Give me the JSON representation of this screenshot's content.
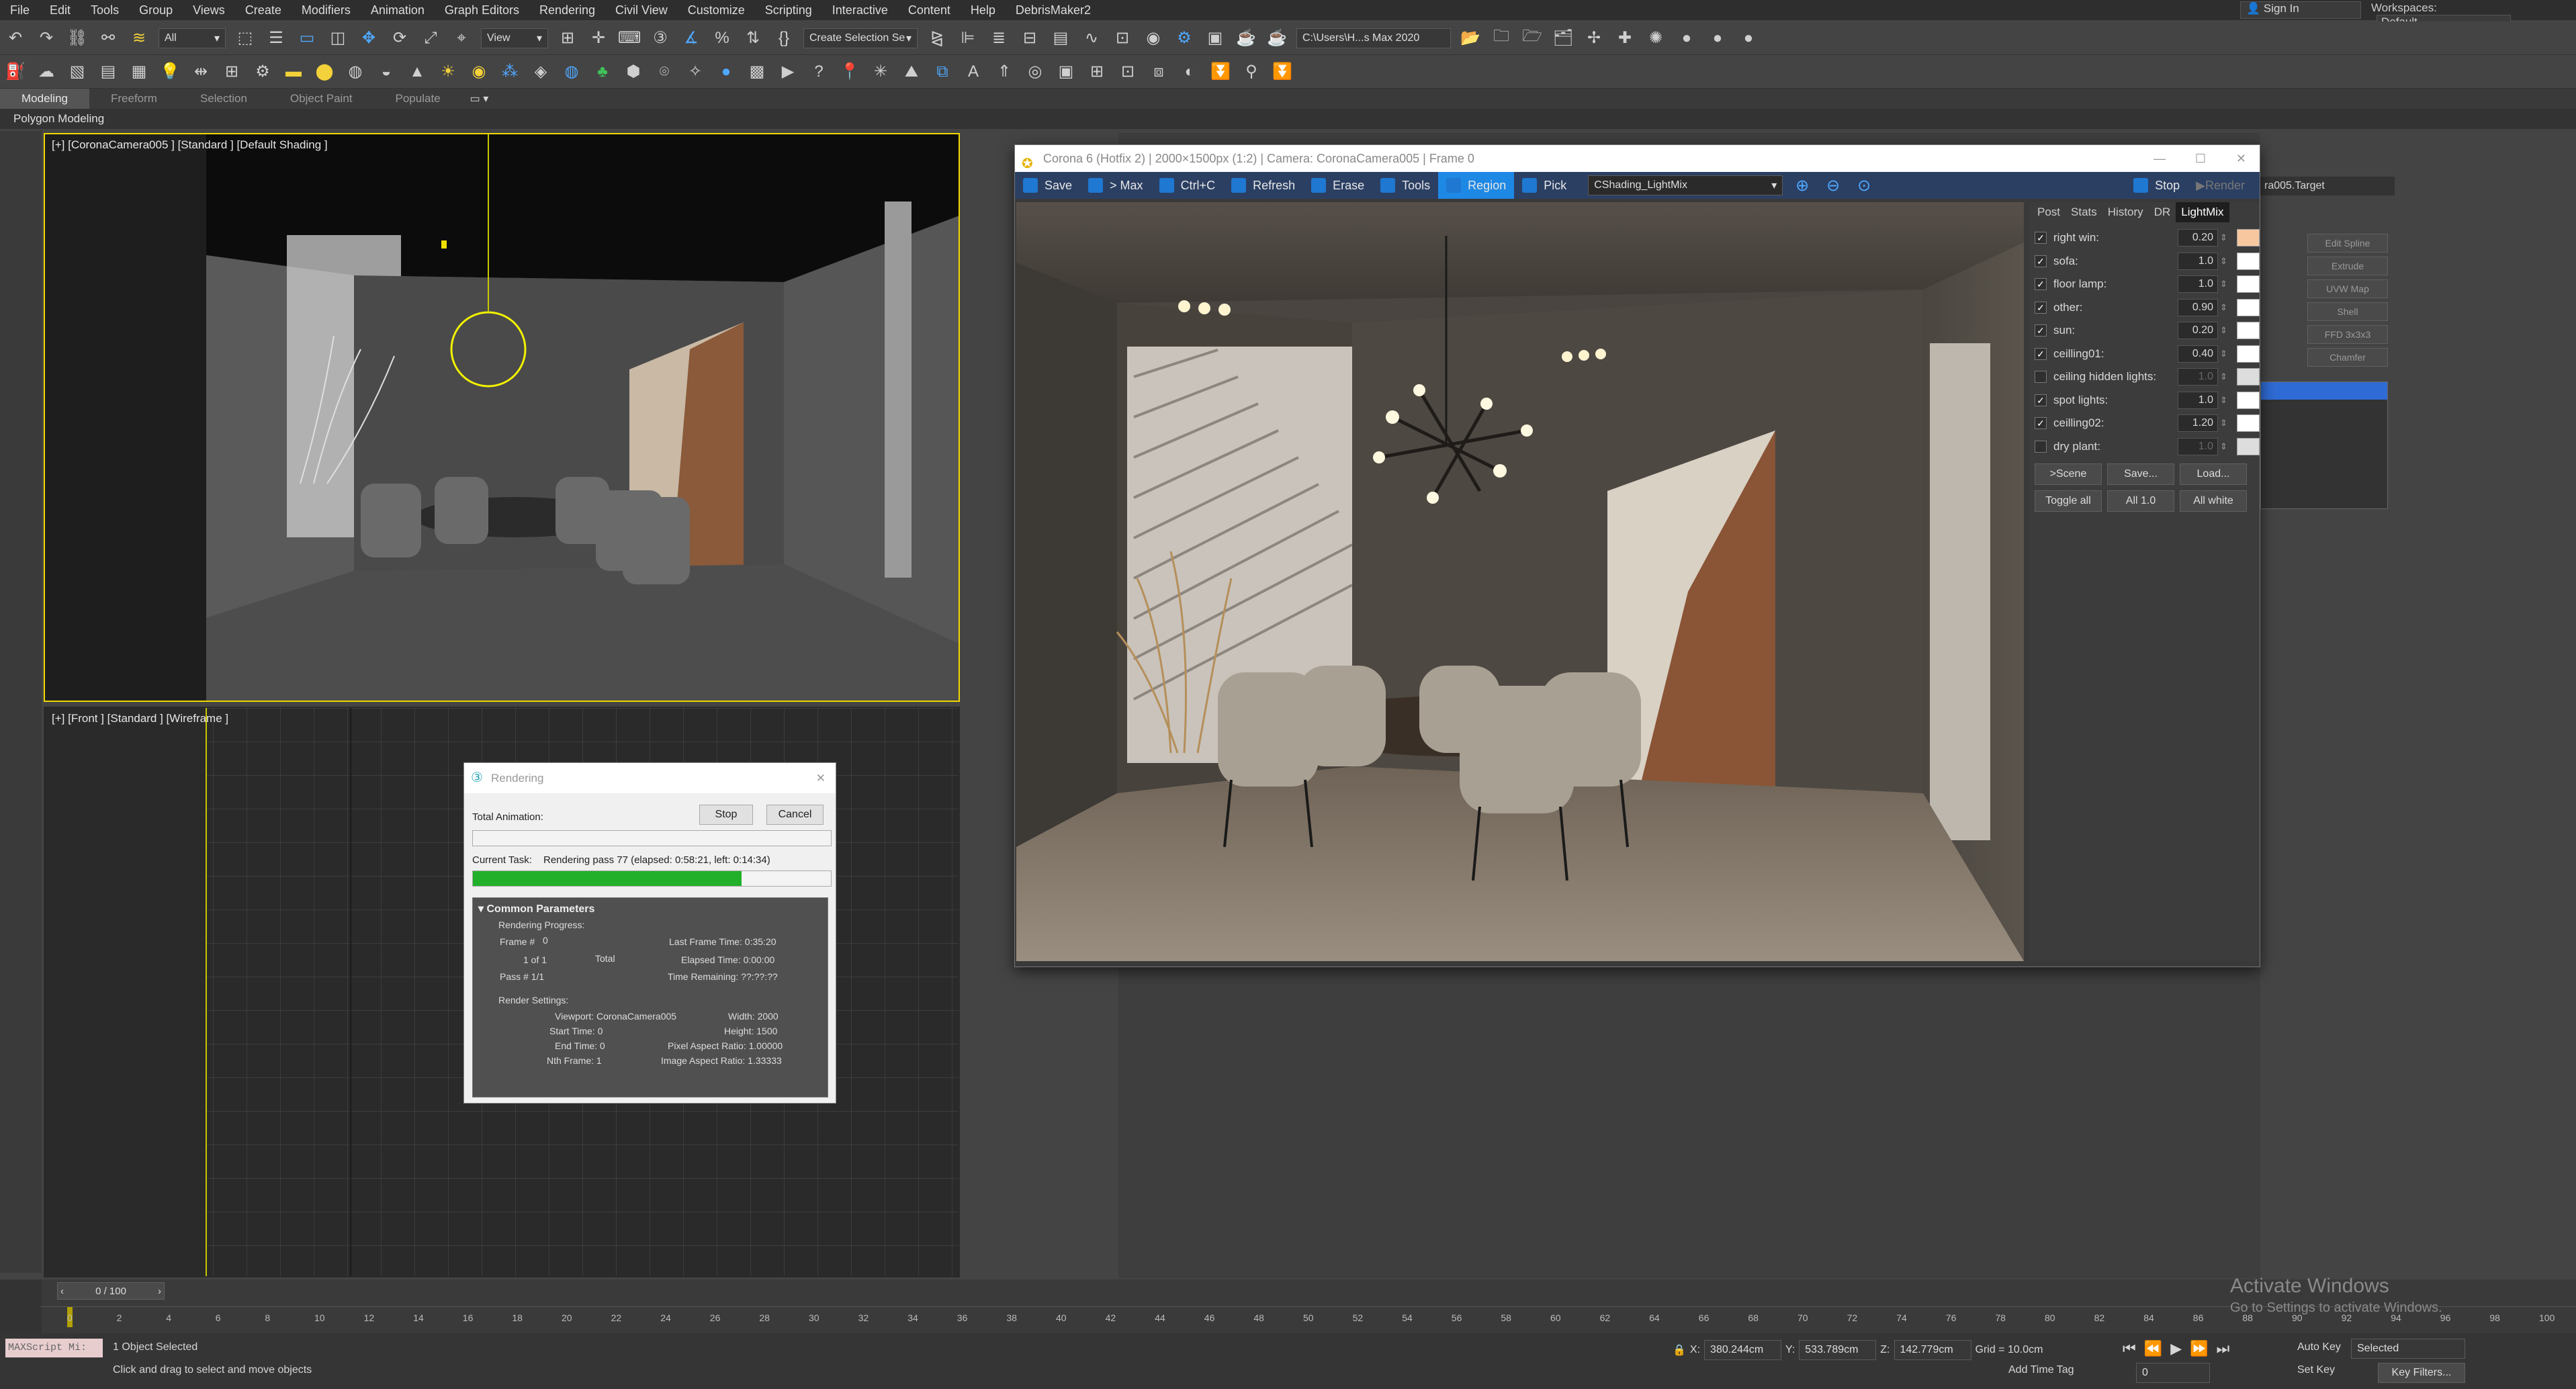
{
  "menu": [
    "File",
    "Edit",
    "Tools",
    "Group",
    "Views",
    "Create",
    "Modifiers",
    "Animation",
    "Graph Editors",
    "Rendering",
    "Civil View",
    "Customize",
    "Scripting",
    "Interactive",
    "Content",
    "Help",
    "DebrisMaker2"
  ],
  "signin": "Sign In",
  "workspaces_label": "Workspaces:",
  "workspaces_value": "Default",
  "toolbar": {
    "filter": "All",
    "ref_coord": "View",
    "selection_set": "Create Selection Se",
    "path": "C:\\Users\\H...s Max 2020"
  },
  "ribbon_tabs": [
    "Modeling",
    "Freeform",
    "Selection",
    "Object Paint",
    "Populate"
  ],
  "ribbon_sub": "Polygon Modeling",
  "viewports": {
    "top_left": "[+] [CoronaCamera005 ] [Standard ] [Default Shading ]",
    "bottom_left": "[+] [Front ] [Standard ] [Wireframe ]"
  },
  "corona_vfb": {
    "title": "Corona 6 (Hotfix 2) | 2000×1500px (1:2) | Camera: CoronaCamera005 | Frame 0",
    "toolbar": [
      "Save",
      "> Max",
      "Ctrl+C",
      "Refresh",
      "Erase",
      "Tools",
      "Region",
      "Pick"
    ],
    "channel": "CShading_LightMix",
    "stop": "Stop",
    "render": "Render",
    "tabs": [
      "Post",
      "Stats",
      "History",
      "DR",
      "LightMix"
    ],
    "lights": [
      {
        "name": "right win:",
        "checked": true,
        "value": "0.20",
        "color": "#f7c8a0"
      },
      {
        "name": "sofa:",
        "checked": true,
        "value": "1.0",
        "color": "#ffffff"
      },
      {
        "name": "floor lamp:",
        "checked": true,
        "value": "1.0",
        "color": "#ffffff"
      },
      {
        "name": "other:",
        "checked": true,
        "value": "0.90",
        "color": "#ffffff"
      },
      {
        "name": "sun:",
        "checked": true,
        "value": "0.20",
        "color": "#ffffff"
      },
      {
        "name": "ceilling01:",
        "checked": true,
        "value": "0.40",
        "color": "#ffffff"
      },
      {
        "name": "ceiling hidden lights:",
        "checked": false,
        "value": "1.0",
        "color": "#dddddd"
      },
      {
        "name": "spot lights:",
        "checked": true,
        "value": "1.0",
        "color": "#ffffff"
      },
      {
        "name": "ceilling02:",
        "checked": true,
        "value": "1.20",
        "color": "#ffffff"
      },
      {
        "name": "dry plant:",
        "checked": false,
        "value": "1.0",
        "color": "#dddddd"
      }
    ],
    "buttons_row1": [
      ">Scene",
      "Save...",
      "Load..."
    ],
    "buttons_row2": [
      "Toggle all",
      "All 1.0",
      "All white"
    ]
  },
  "right_panel": {
    "target": "ra005.Target",
    "modifiers": [
      "Edit Spline",
      "Extrude",
      "UVW Map",
      "Shell",
      "FFD 3x3x3",
      "Chamfer"
    ]
  },
  "rendering_dialog": {
    "title": "Rendering",
    "stop": "Stop",
    "cancel": "Cancel",
    "total_animation": "Total Animation:",
    "current_task_label": "Current Task:",
    "current_task": "Rendering pass 77 (elapsed: 0:58:21, left: 0:14:34)",
    "progress": 0.75,
    "section": "Common Parameters",
    "rendering_progress": "Rendering Progress:",
    "frame_label": "Frame #",
    "frame": "0",
    "of": "1 of 1",
    "total": "Total",
    "pass": "Pass #  1/1",
    "last_frame_time": "Last Frame Time:  0:35:20",
    "elapsed_time": "Elapsed Time:  0:00:00",
    "time_remaining": "Time Remaining:  ??:??:??",
    "render_settings": "Render Settings:",
    "viewport": "Viewport:  CoronaCamera005",
    "width": "Width:  2000",
    "start_time": "Start Time:  0",
    "height": "Height:  1500",
    "end_time": "End Time:  0",
    "pixel_aspect": "Pixel Aspect Ratio:  1.00000",
    "nth_frame": "Nth Frame:  1",
    "image_aspect": "Image Aspect Ratio:  1.33333"
  },
  "timeline": {
    "frame_counter": "0 / 100",
    "ticks": [
      "0",
      "2",
      "4",
      "6",
      "8",
      "10",
      "12",
      "14",
      "16",
      "18",
      "20",
      "22",
      "24",
      "26",
      "28",
      "30",
      "32",
      "34",
      "36",
      "38",
      "40",
      "42",
      "44",
      "46",
      "48",
      "50",
      "52",
      "54",
      "56",
      "58",
      "60",
      "62",
      "64",
      "66",
      "68",
      "70",
      "72",
      "74",
      "76",
      "78",
      "80",
      "82",
      "84",
      "86",
      "88",
      "90",
      "92",
      "94",
      "96",
      "98",
      "100"
    ]
  },
  "status": {
    "maxscript": "MAXScript Mi:",
    "selected": "1 Object Selected",
    "prompt": "Click and drag to select and move objects",
    "x": "380.244cm",
    "y": "533.789cm",
    "z": "142.779cm",
    "grid": "Grid = 10.0cm",
    "add_time_tag": "Add Time Tag",
    "auto_key": "Auto Key",
    "set_key": "Set Key",
    "selected_dd": "Selected",
    "key_filters": "Key Filters...",
    "frame_field": "0"
  },
  "watermark": {
    "line1": "Activate Windows",
    "line2": "Go to Settings to activate Windows."
  }
}
